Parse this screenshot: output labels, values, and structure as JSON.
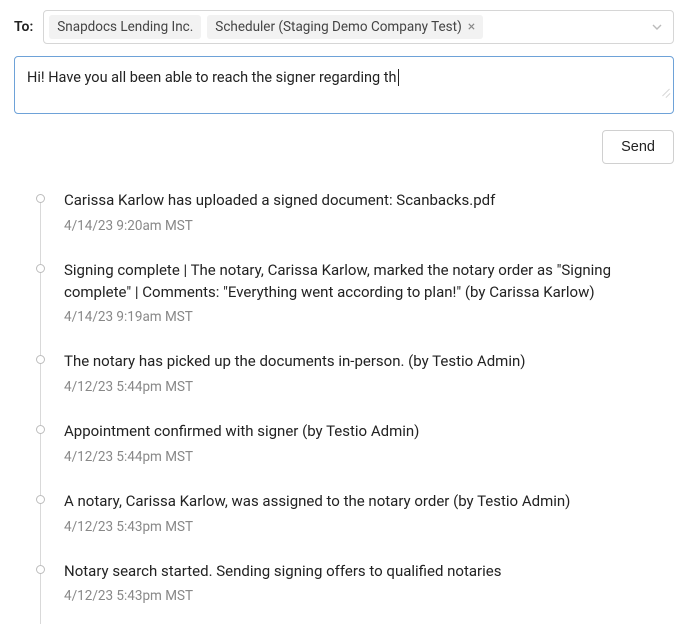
{
  "to_label": "To:",
  "recipients": [
    {
      "label": "Snapdocs Lending Inc.",
      "removable": false
    },
    {
      "label": "Scheduler (Staging Demo Company Test)",
      "removable": true
    }
  ],
  "message_value": "Hi! Have you all been able to reach the signer regarding th",
  "send_label": "Send",
  "events": [
    {
      "text": "Carissa Karlow has uploaded a signed document: Scanbacks.pdf",
      "ts": "4/14/23 9:20am MST"
    },
    {
      "text": "Signing complete | The notary, Carissa Karlow, marked the notary order as \"Signing complete\" | Comments: \"Everything went according to plan!\" (by Carissa Karlow)",
      "ts": "4/14/23 9:19am MST"
    },
    {
      "text": "The notary has picked up the documents in-person. (by Testio Admin)",
      "ts": "4/12/23 5:44pm MST"
    },
    {
      "text": "Appointment confirmed with signer (by Testio Admin)",
      "ts": "4/12/23 5:44pm MST"
    },
    {
      "text": "A notary, Carissa Karlow, was assigned to the notary order (by Testio Admin)",
      "ts": "4/12/23 5:43pm MST"
    },
    {
      "text": "Notary search started. Sending signing offers to qualified notaries",
      "ts": "4/12/23 5:43pm MST"
    }
  ]
}
